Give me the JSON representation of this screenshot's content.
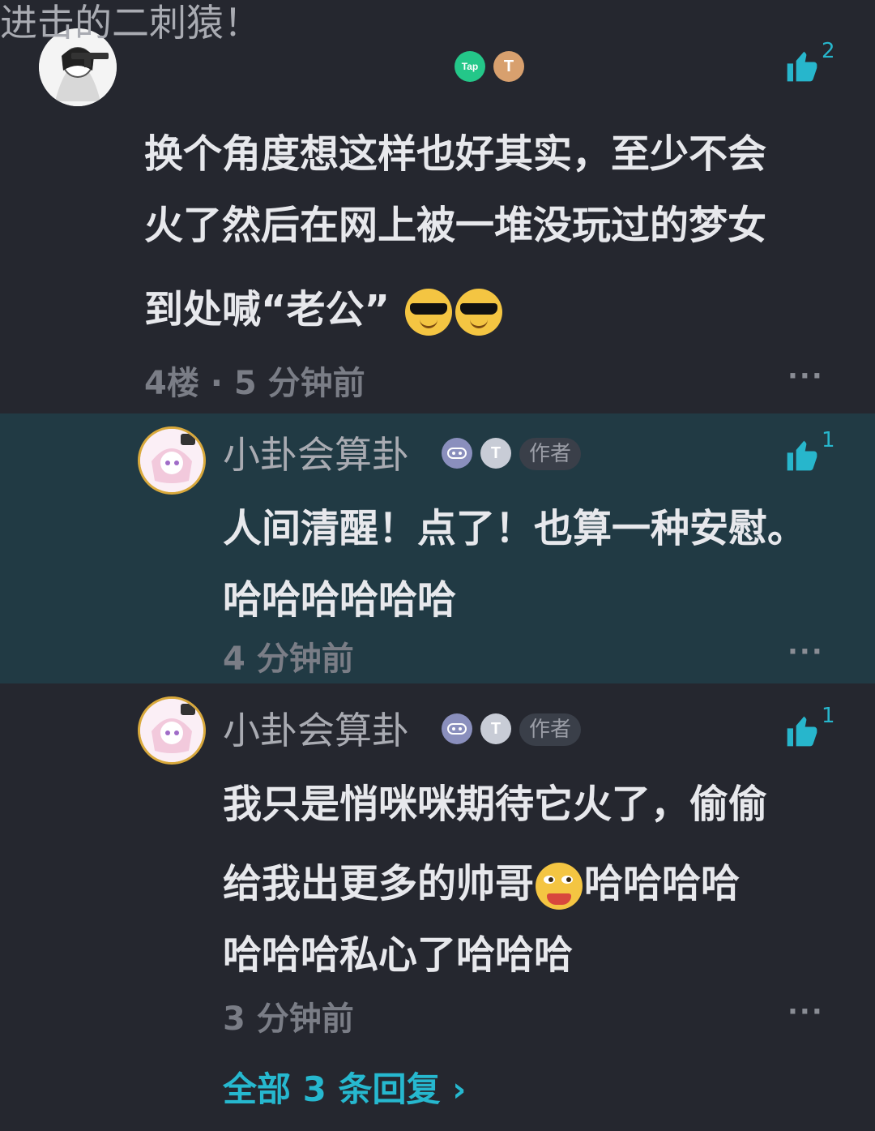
{
  "comment": {
    "username": "进击的二刺猿！",
    "badges": [
      "Tap",
      "T"
    ],
    "likes": "2",
    "lines": [
      "换个角度想这样也好其实，至少不会",
      "火了然后在网上被一堆没玩过的梦女",
      "到处喊“老公”"
    ],
    "meta": "4楼 · 5 分钟前",
    "more": "···"
  },
  "replies": [
    {
      "username": "小卦会算卦",
      "badge_t": "T",
      "author_tag": "作者",
      "likes": "1",
      "lines": [
        "人间清醒！点了！也算一种安慰。",
        "哈哈哈哈哈哈"
      ],
      "time": "4 分钟前",
      "more": "···"
    },
    {
      "username": "小卦会算卦",
      "badge_t": "T",
      "author_tag": "作者",
      "likes": "1",
      "line1": "我只是悄咪咪期待它火了，偷偷",
      "line2a": "给我出更多的帅哥",
      "line2b": "哈哈哈哈",
      "line3": "哈哈哈私心了哈哈哈",
      "time": "3 分钟前",
      "more": "···"
    }
  ],
  "view_all": "全部 3 条回复 ›",
  "colors": {
    "accent": "#26b8cf",
    "background": "#25272f",
    "highlight": "#213a44"
  }
}
